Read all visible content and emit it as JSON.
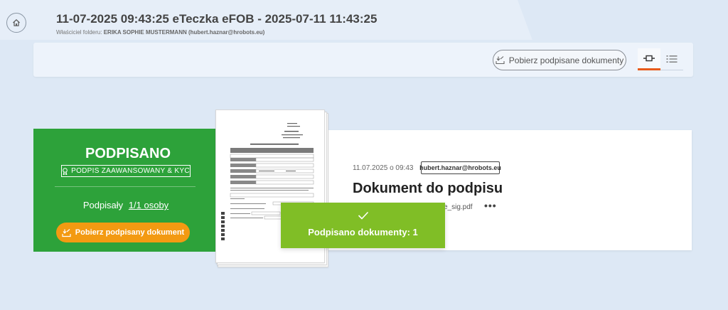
{
  "header": {
    "title": "11-07-2025 09:43:25 eTeczka eFOB - 2025-07-11 11:43:25",
    "owner_label": "Właściciel folderu:",
    "owner_value": "ERIKA SOPHIE MUSTERMANN (hubert.haznar@hrobots.eu)"
  },
  "toolbar": {
    "download_signed_label": "Pobierz podpisane dokumenty",
    "view_card_icon": "card-view-icon",
    "view_list_icon": "list-view-icon",
    "active_tab_color": "#e85a1a"
  },
  "status_panel": {
    "title": "PODPISANO",
    "badge": "PODPIS ZAAWANSOWANY & KYC",
    "signed_label": "Podpisały",
    "signed_value": "1/1 osoby",
    "download_label": "Pobierz podpisany dokument",
    "color": "#2da23a",
    "button_color": "#f39a12"
  },
  "document": {
    "date": "11.07.2025 o 09:43",
    "email": "hubert.haznar@hrobots.eu",
    "name": "Dokument do podpisu",
    "file": "e_sig.pdf",
    "more": "•••"
  },
  "toast": {
    "message": "Podpisano dokumenty: 1",
    "color": "#80be26"
  }
}
